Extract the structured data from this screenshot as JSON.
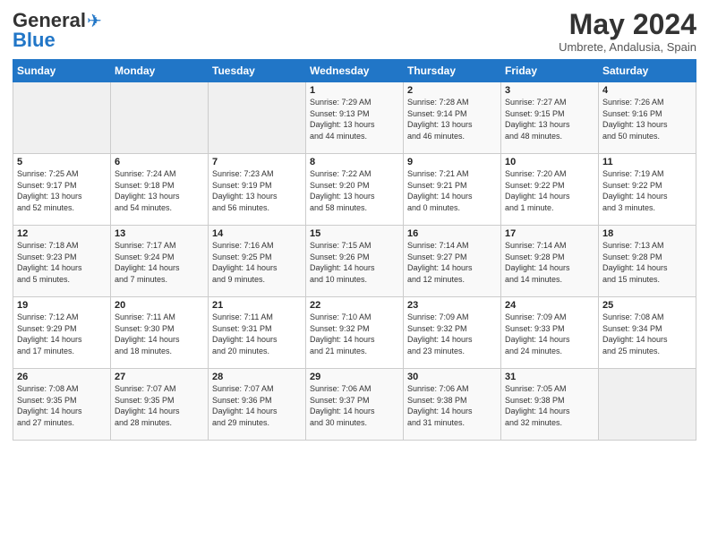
{
  "header": {
    "logo_general": "General",
    "logo_blue": "Blue",
    "month_title": "May 2024",
    "location": "Umbrete, Andalusia, Spain"
  },
  "days_of_week": [
    "Sunday",
    "Monday",
    "Tuesday",
    "Wednesday",
    "Thursday",
    "Friday",
    "Saturday"
  ],
  "weeks": [
    [
      {
        "day": "",
        "info": ""
      },
      {
        "day": "",
        "info": ""
      },
      {
        "day": "",
        "info": ""
      },
      {
        "day": "1",
        "info": "Sunrise: 7:29 AM\nSunset: 9:13 PM\nDaylight: 13 hours\nand 44 minutes."
      },
      {
        "day": "2",
        "info": "Sunrise: 7:28 AM\nSunset: 9:14 PM\nDaylight: 13 hours\nand 46 minutes."
      },
      {
        "day": "3",
        "info": "Sunrise: 7:27 AM\nSunset: 9:15 PM\nDaylight: 13 hours\nand 48 minutes."
      },
      {
        "day": "4",
        "info": "Sunrise: 7:26 AM\nSunset: 9:16 PM\nDaylight: 13 hours\nand 50 minutes."
      }
    ],
    [
      {
        "day": "5",
        "info": "Sunrise: 7:25 AM\nSunset: 9:17 PM\nDaylight: 13 hours\nand 52 minutes."
      },
      {
        "day": "6",
        "info": "Sunrise: 7:24 AM\nSunset: 9:18 PM\nDaylight: 13 hours\nand 54 minutes."
      },
      {
        "day": "7",
        "info": "Sunrise: 7:23 AM\nSunset: 9:19 PM\nDaylight: 13 hours\nand 56 minutes."
      },
      {
        "day": "8",
        "info": "Sunrise: 7:22 AM\nSunset: 9:20 PM\nDaylight: 13 hours\nand 58 minutes."
      },
      {
        "day": "9",
        "info": "Sunrise: 7:21 AM\nSunset: 9:21 PM\nDaylight: 14 hours\nand 0 minutes."
      },
      {
        "day": "10",
        "info": "Sunrise: 7:20 AM\nSunset: 9:22 PM\nDaylight: 14 hours\nand 1 minute."
      },
      {
        "day": "11",
        "info": "Sunrise: 7:19 AM\nSunset: 9:22 PM\nDaylight: 14 hours\nand 3 minutes."
      }
    ],
    [
      {
        "day": "12",
        "info": "Sunrise: 7:18 AM\nSunset: 9:23 PM\nDaylight: 14 hours\nand 5 minutes."
      },
      {
        "day": "13",
        "info": "Sunrise: 7:17 AM\nSunset: 9:24 PM\nDaylight: 14 hours\nand 7 minutes."
      },
      {
        "day": "14",
        "info": "Sunrise: 7:16 AM\nSunset: 9:25 PM\nDaylight: 14 hours\nand 9 minutes."
      },
      {
        "day": "15",
        "info": "Sunrise: 7:15 AM\nSunset: 9:26 PM\nDaylight: 14 hours\nand 10 minutes."
      },
      {
        "day": "16",
        "info": "Sunrise: 7:14 AM\nSunset: 9:27 PM\nDaylight: 14 hours\nand 12 minutes."
      },
      {
        "day": "17",
        "info": "Sunrise: 7:14 AM\nSunset: 9:28 PM\nDaylight: 14 hours\nand 14 minutes."
      },
      {
        "day": "18",
        "info": "Sunrise: 7:13 AM\nSunset: 9:28 PM\nDaylight: 14 hours\nand 15 minutes."
      }
    ],
    [
      {
        "day": "19",
        "info": "Sunrise: 7:12 AM\nSunset: 9:29 PM\nDaylight: 14 hours\nand 17 minutes."
      },
      {
        "day": "20",
        "info": "Sunrise: 7:11 AM\nSunset: 9:30 PM\nDaylight: 14 hours\nand 18 minutes."
      },
      {
        "day": "21",
        "info": "Sunrise: 7:11 AM\nSunset: 9:31 PM\nDaylight: 14 hours\nand 20 minutes."
      },
      {
        "day": "22",
        "info": "Sunrise: 7:10 AM\nSunset: 9:32 PM\nDaylight: 14 hours\nand 21 minutes."
      },
      {
        "day": "23",
        "info": "Sunrise: 7:09 AM\nSunset: 9:32 PM\nDaylight: 14 hours\nand 23 minutes."
      },
      {
        "day": "24",
        "info": "Sunrise: 7:09 AM\nSunset: 9:33 PM\nDaylight: 14 hours\nand 24 minutes."
      },
      {
        "day": "25",
        "info": "Sunrise: 7:08 AM\nSunset: 9:34 PM\nDaylight: 14 hours\nand 25 minutes."
      }
    ],
    [
      {
        "day": "26",
        "info": "Sunrise: 7:08 AM\nSunset: 9:35 PM\nDaylight: 14 hours\nand 27 minutes."
      },
      {
        "day": "27",
        "info": "Sunrise: 7:07 AM\nSunset: 9:35 PM\nDaylight: 14 hours\nand 28 minutes."
      },
      {
        "day": "28",
        "info": "Sunrise: 7:07 AM\nSunset: 9:36 PM\nDaylight: 14 hours\nand 29 minutes."
      },
      {
        "day": "29",
        "info": "Sunrise: 7:06 AM\nSunset: 9:37 PM\nDaylight: 14 hours\nand 30 minutes."
      },
      {
        "day": "30",
        "info": "Sunrise: 7:06 AM\nSunset: 9:38 PM\nDaylight: 14 hours\nand 31 minutes."
      },
      {
        "day": "31",
        "info": "Sunrise: 7:05 AM\nSunset: 9:38 PM\nDaylight: 14 hours\nand 32 minutes."
      },
      {
        "day": "",
        "info": ""
      }
    ]
  ]
}
